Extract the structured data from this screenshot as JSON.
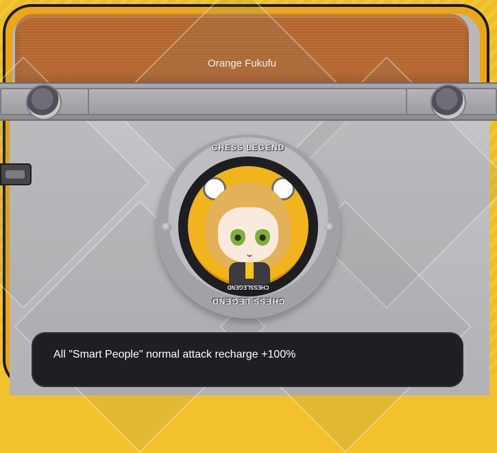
{
  "card": {
    "name": "Orange Fukufu",
    "description": "All \"Smart People\" normal attack recharge +100%"
  },
  "medal": {
    "top_text": "CHESS LEGEND",
    "bottom_text": "CHESS LEGEND",
    "small_text": "CHESSLEGEND"
  },
  "colors": {
    "background": "#f2c22a",
    "card_frame": "#e9a719",
    "header": "#b96c31",
    "plate": "#bcbcc0",
    "description_box": "#1f1f23"
  }
}
